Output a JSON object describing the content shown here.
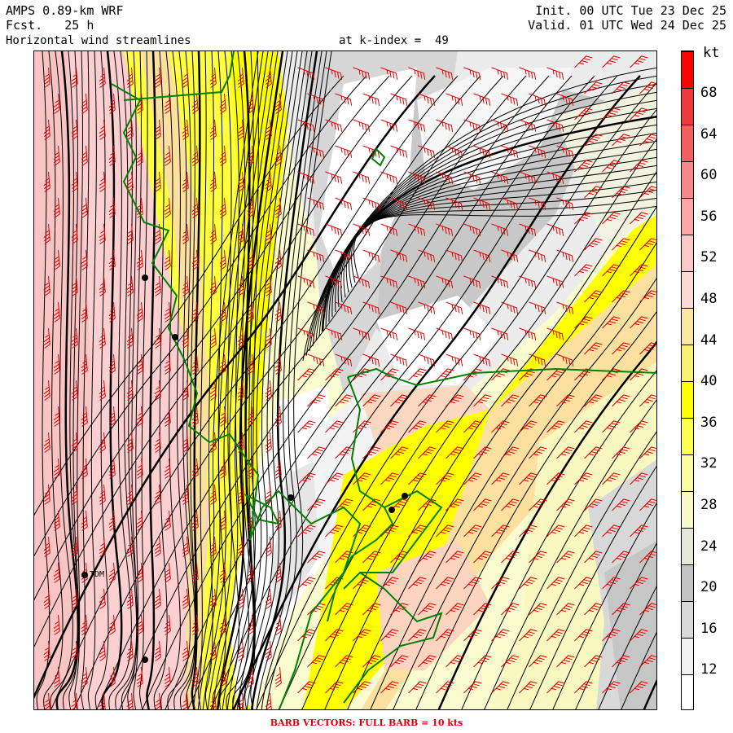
{
  "header": {
    "model": "AMPS 0.89-km WRF",
    "forecast": "Fcst.   25 h",
    "title": "Horizontal wind streamlines",
    "init": "Init. 00 UTC Tue 23 Dec 25",
    "valid": "Valid. 01 UTC Wed 24 Dec 25",
    "level": "at k-index =  49"
  },
  "colorbar": {
    "unit": "kt",
    "tick_labels": [
      "68",
      "64",
      "60",
      "56",
      "52",
      "48",
      "44",
      "40",
      "36",
      "32",
      "28",
      "24",
      "20",
      "16",
      "12"
    ],
    "colors_bottom_to_top": [
      "#ffffff",
      "#f0f0f0",
      "#d8d8d8",
      "#c4c4c4",
      "#e8e8d8",
      "#f8f8c8",
      "#fcfca0",
      "#ffff50",
      "#ffff00",
      "#f8f070",
      "#fce8a0",
      "#fcd8d8",
      "#fcc8c8",
      "#fca8a8",
      "#f88888",
      "#f46060",
      "#f03838",
      "#ff0000"
    ]
  },
  "map": {
    "station_label": "TDM",
    "colors": {
      "coast": "#008000",
      "barb": "#e00000",
      "streamline": "#000000"
    }
  },
  "footer": "BARB VECTORS:  FULL BARB = 10 kts"
}
